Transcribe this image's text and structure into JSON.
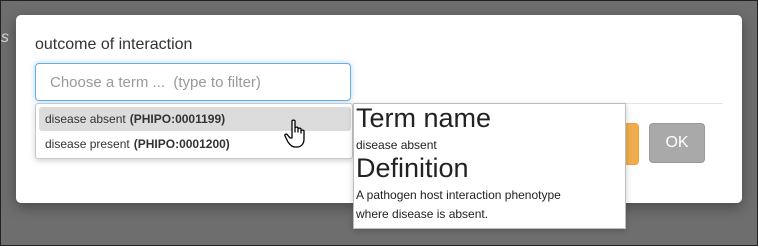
{
  "background": {
    "italic_text": "s"
  },
  "modal": {
    "field_label": "outcome of interaction",
    "input": {
      "placeholder": "Choose a term ...  (type to filter)",
      "value": ""
    },
    "ok_label": "OK"
  },
  "dropdown": {
    "items": [
      {
        "name": "disease absent",
        "term_id": "(PHIPO:0001199)",
        "highlighted": true
      },
      {
        "name": "disease present",
        "term_id": "(PHIPO:0001200)",
        "highlighted": false
      }
    ]
  },
  "popover": {
    "name_heading": "Term name",
    "name_value": "disease absent",
    "definition_heading": "Definition",
    "definition_line1": "A pathogen host interaction phenotype",
    "definition_line2": "where disease is absent."
  },
  "colors": {
    "input_focus": "#66afe9",
    "highlight": "#dcdcdc",
    "ok_button": "#a9a9a9",
    "warning_button": "#f0ad4e"
  },
  "icons": {
    "cursor": "hand-pointer-icon"
  }
}
